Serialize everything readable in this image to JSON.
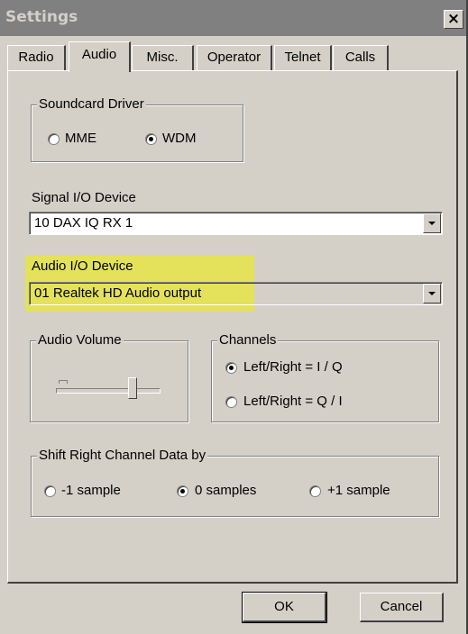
{
  "window": {
    "title": "Settings",
    "close_glyph": "×"
  },
  "tabs": [
    {
      "label": "Radio",
      "active": false
    },
    {
      "label": "Audio",
      "active": true
    },
    {
      "label": "Misc.",
      "active": false
    },
    {
      "label": "Operator",
      "active": false
    },
    {
      "label": "Telnet",
      "active": false
    },
    {
      "label": "Calls",
      "active": false
    }
  ],
  "soundcard_driver": {
    "title": "Soundcard Driver",
    "options": [
      {
        "label": "MME",
        "selected": false
      },
      {
        "label": "WDM",
        "selected": true
      }
    ]
  },
  "signal_io": {
    "label": "Signal I/O Device",
    "value": "10  DAX IQ RX 1"
  },
  "audio_io": {
    "label": "Audio I/O Device",
    "value": "01  Realtek HD Audio output",
    "highlight_color": "#f0f000"
  },
  "audio_volume": {
    "title": "Audio Volume",
    "level_fraction": 0.75
  },
  "channels": {
    "title": "Channels",
    "options": [
      {
        "label": "Left/Right = I / Q",
        "selected": true
      },
      {
        "label": "Left/Right = Q / I",
        "selected": false
      }
    ]
  },
  "shift_right": {
    "title": "Shift Right Channel Data by",
    "options": [
      {
        "label": "-1 sample",
        "selected": false
      },
      {
        "label": "0 samples",
        "selected": true
      },
      {
        "label": "+1 sample",
        "selected": false
      }
    ]
  },
  "buttons": {
    "ok": "OK",
    "cancel": "Cancel"
  }
}
